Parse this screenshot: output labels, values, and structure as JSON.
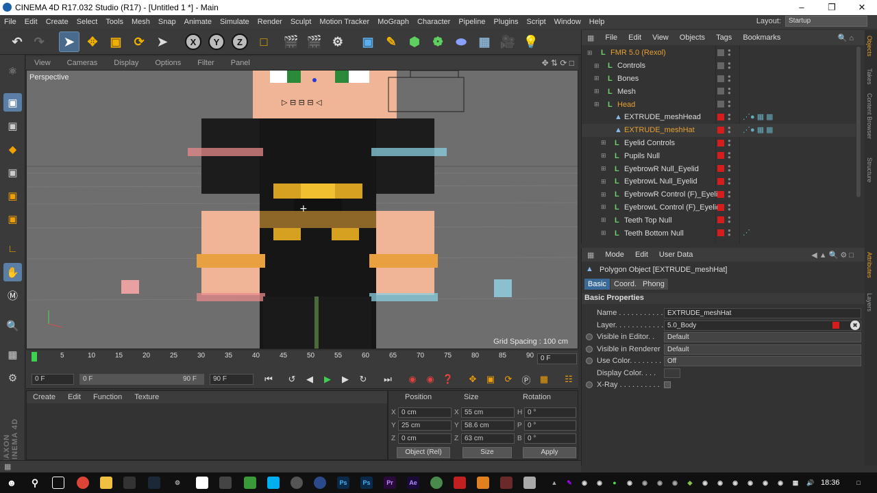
{
  "window": {
    "title": "CINEMA 4D R17.032 Studio (R17) - [Untitled 1 *] - Main"
  },
  "menu": [
    "File",
    "Edit",
    "Create",
    "Select",
    "Tools",
    "Mesh",
    "Snap",
    "Animate",
    "Simulate",
    "Render",
    "Sculpt",
    "Motion Tracker",
    "MoGraph",
    "Character",
    "Pipeline",
    "Plugins",
    "Script",
    "Window",
    "Help"
  ],
  "layout": {
    "label": "Layout:",
    "value": "Startup"
  },
  "toolbar": {
    "x": "X",
    "y": "Y",
    "z": "Z"
  },
  "viewport": {
    "menu": [
      "View",
      "Cameras",
      "Display",
      "Options",
      "Filter",
      "Panel"
    ],
    "camera_label": "Perspective",
    "grid_spacing": "Grid Spacing : 100 cm"
  },
  "timeline": {
    "ticks": [
      "0",
      "5",
      "10",
      "15",
      "20",
      "25",
      "30",
      "35",
      "40",
      "45",
      "50",
      "55",
      "60",
      "65",
      "70",
      "75",
      "80",
      "85",
      "90"
    ],
    "current_frame": "0 F",
    "start": "0 F",
    "range_start": "0 F",
    "range_end": "90 F",
    "end": "90 F"
  },
  "material_manager": {
    "menu": [
      "Create",
      "Edit",
      "Function",
      "Texture"
    ]
  },
  "coordinates": {
    "headers": [
      "Position",
      "Size",
      "Rotation"
    ],
    "rows": [
      {
        "axis": "X",
        "pos": "0 cm",
        "size_axis": "X",
        "size": "55 cm",
        "rot_axis": "H",
        "rot": "0 °"
      },
      {
        "axis": "Y",
        "pos": "25 cm",
        "size_axis": "Y",
        "size": "58.6 cm",
        "rot_axis": "P",
        "rot": "0 °"
      },
      {
        "axis": "Z",
        "pos": "0 cm",
        "size_axis": "Z",
        "size": "63 cm",
        "rot_axis": "B",
        "rot": "0 °"
      }
    ],
    "mode": "Object (Rel)",
    "size_mode": "Size",
    "apply": "Apply"
  },
  "object_manager": {
    "menu": [
      "File",
      "Edit",
      "View",
      "Objects",
      "Tags",
      "Bookmarks"
    ],
    "objects": [
      {
        "name": "FMR 5.0 (Rexol)",
        "indent": 0,
        "icon": "null",
        "color": "orange",
        "layer": false,
        "tags": ""
      },
      {
        "name": "Controls",
        "indent": 1,
        "icon": "null",
        "color": "normal",
        "layer": false,
        "tags": ""
      },
      {
        "name": "Bones",
        "indent": 1,
        "icon": "null",
        "color": "normal",
        "layer": false,
        "tags": ""
      },
      {
        "name": "Mesh",
        "indent": 1,
        "icon": "null",
        "color": "normal",
        "layer": false,
        "tags": ""
      },
      {
        "name": "Head",
        "indent": 1,
        "icon": "null",
        "color": "orange",
        "layer": false,
        "tags": ""
      },
      {
        "name": "EXTRUDE_meshHead",
        "indent": 2,
        "icon": "poly",
        "color": "normal",
        "layer": true,
        "tags": "tex"
      },
      {
        "name": "EXTRUDE_meshHat",
        "indent": 2,
        "icon": "poly",
        "color": "orange",
        "layer": true,
        "tags": "tex"
      },
      {
        "name": "Eyelid Controls",
        "indent": 2,
        "icon": "null",
        "color": "normal",
        "layer": true,
        "tags": ""
      },
      {
        "name": "Pupils Null",
        "indent": 2,
        "icon": "null",
        "color": "normal",
        "layer": true,
        "tags": ""
      },
      {
        "name": "EyebrowR Null_Eyelid",
        "indent": 2,
        "icon": "null",
        "color": "normal",
        "layer": true,
        "tags": ""
      },
      {
        "name": "EyebrowL Null_Eyelid",
        "indent": 2,
        "icon": "null",
        "color": "normal",
        "layer": true,
        "tags": ""
      },
      {
        "name": "EyebrowR Control (F)_Eyelid",
        "indent": 2,
        "icon": "null",
        "color": "normal",
        "layer": true,
        "tags": ""
      },
      {
        "name": "EyebrowL Control (F)_Eyelid",
        "indent": 2,
        "icon": "null",
        "color": "normal",
        "layer": true,
        "tags": ""
      },
      {
        "name": "Teeth Top Null",
        "indent": 2,
        "icon": "null",
        "color": "normal",
        "layer": true,
        "tags": ""
      },
      {
        "name": "Teeth Bottom Null",
        "indent": 2,
        "icon": "null",
        "color": "normal",
        "layer": true,
        "tags": "ik"
      }
    ]
  },
  "attributes": {
    "menu": [
      "Mode",
      "Edit",
      "User Data"
    ],
    "object_title": "Polygon Object [EXTRUDE_meshHat]",
    "tabs": [
      "Basic",
      "Coord.",
      "Phong"
    ],
    "section": "Basic Properties",
    "fields": [
      {
        "label": "Name . . . . . . . . . . . .",
        "value": "EXTRUDE_meshHat",
        "kind": "text",
        "radio": false
      },
      {
        "label": "Layer. . . . . . . . . . . .",
        "value": "5.0_Body",
        "kind": "text",
        "radio": false
      },
      {
        "label": "Visible in Editor. .",
        "value": "Default",
        "kind": "dropdown",
        "radio": true
      },
      {
        "label": "Visible in Renderer",
        "value": "Default",
        "kind": "dropdown",
        "radio": true
      },
      {
        "label": "Use Color. . . . . . . .",
        "value": "Off",
        "kind": "dropdown",
        "radio": true
      },
      {
        "label": "Display Color. . . .",
        "value": "",
        "kind": "color",
        "radio": false
      },
      {
        "label": "X-Ray . . . . . . . . . .",
        "value": "",
        "kind": "check",
        "radio": true
      }
    ]
  },
  "side_tabs": [
    "Objects",
    "Takes",
    "Content Browser",
    "Structure",
    "Attributes",
    "Layers"
  ],
  "maxon_brand": "MAXON CINEMA 4D",
  "clock": "18:36",
  "colors": {
    "accent": "#3a6a9a",
    "layer_red": "#d81c1c",
    "orange_text": "#e8a030",
    "null_green": "#6cd36c"
  }
}
